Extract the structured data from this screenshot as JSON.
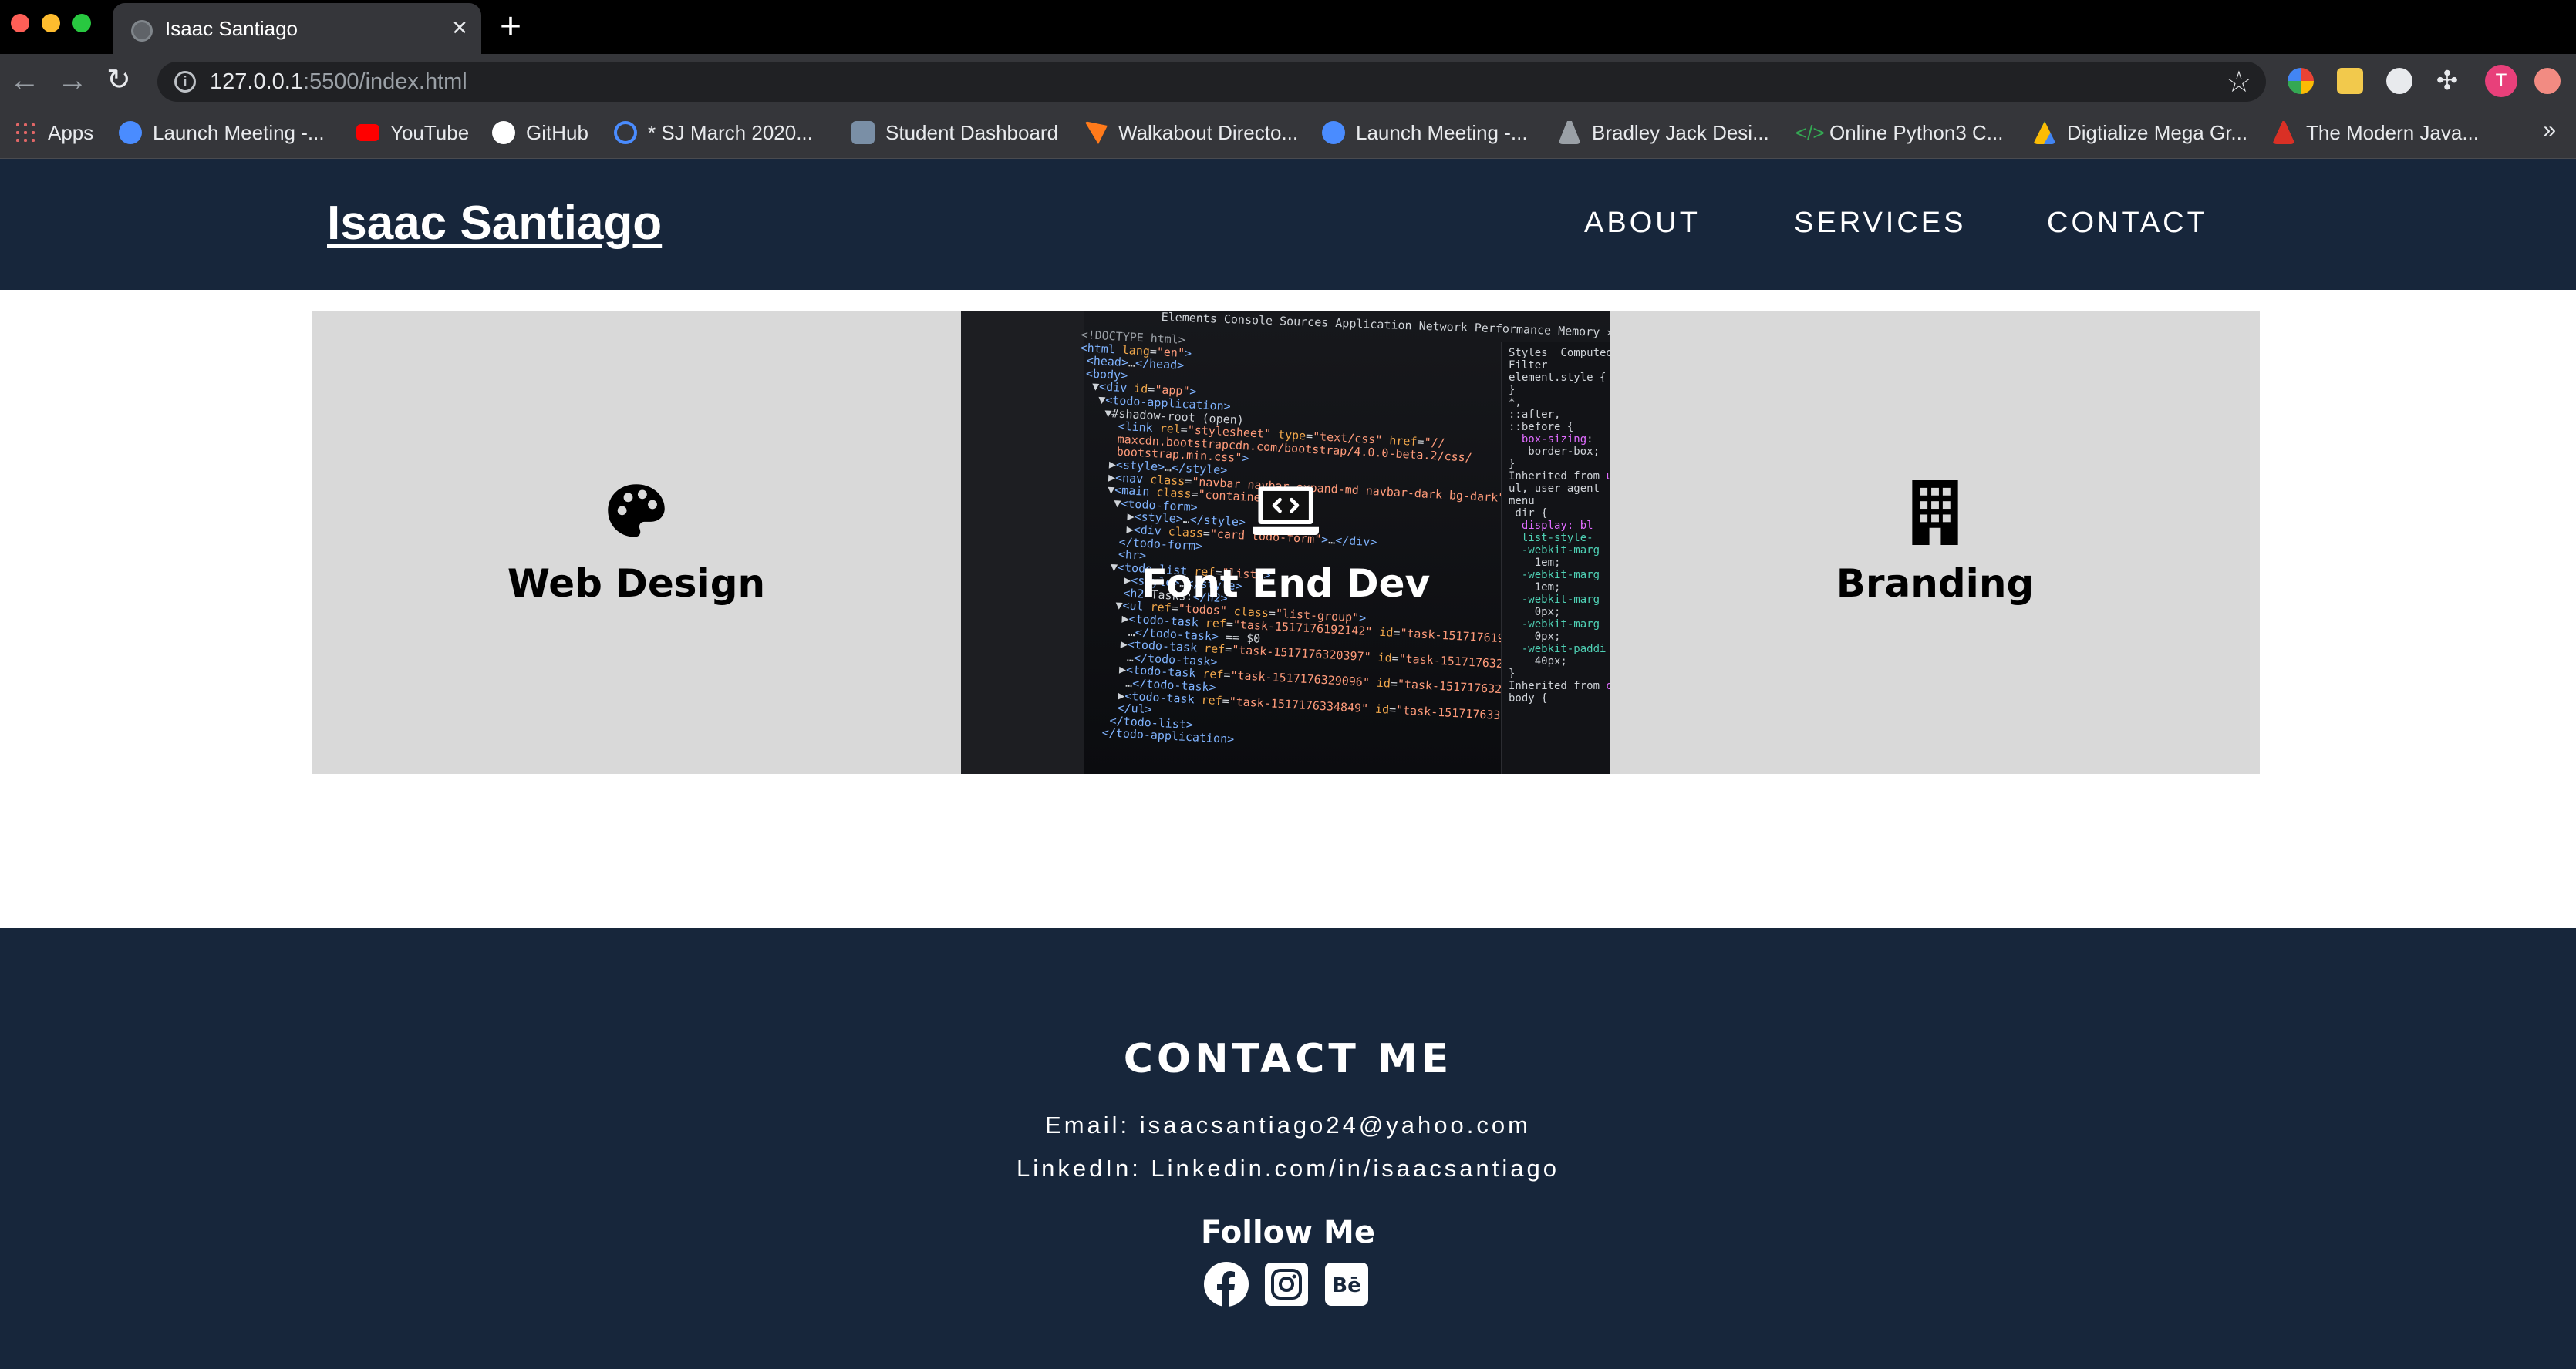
{
  "browser": {
    "tab_title": "Isaac Santiago",
    "tab_close": "×",
    "new_tab": "+",
    "url_host": "127.0.0.1",
    "url_rest": ":5500/index.html",
    "avatar_letter": "T",
    "bookmarks": [
      {
        "label": "Apps",
        "icon": "apps-grid-icon",
        "color": "#e06666"
      },
      {
        "label": "Launch Meeting -...",
        "icon": "zoom-icon",
        "color": "#4a8cff"
      },
      {
        "label": "YouTube",
        "icon": "youtube-icon",
        "color": "#ff0000"
      },
      {
        "label": "GitHub",
        "icon": "github-icon",
        "color": "#ffffff"
      },
      {
        "label": "* SJ March 2020...",
        "icon": "timer-icon",
        "color": "#4a8cff"
      },
      {
        "label": "Student Dashboard",
        "icon": "dashboard-icon",
        "color": "#7a8fa6"
      },
      {
        "label": "Walkabout Directo...",
        "icon": "walkabout-icon",
        "color": "#ff7a1a"
      },
      {
        "label": "Launch Meeting -...",
        "icon": "zoom-icon",
        "color": "#4a8cff"
      },
      {
        "label": "Bradley Jack Desi...",
        "icon": "figure-icon",
        "color": "#9aa0a6"
      },
      {
        "label": "Online Python3 C...",
        "icon": "code-icon",
        "color": "#34a853"
      },
      {
        "label": "Digtialize Mega Gr...",
        "icon": "google-drive-icon",
        "color": "#fbbc05"
      },
      {
        "label": "The Modern Java...",
        "icon": "figure-red-icon",
        "color": "#d93025"
      }
    ],
    "bookmarks_more": "»"
  },
  "site": {
    "brand": "Isaac Santiago",
    "nav": {
      "about": "ABOUT",
      "services": "SERVICES",
      "contact": "CONTACT"
    },
    "services": [
      {
        "title": "Web Design",
        "icon": "palette-icon"
      },
      {
        "title": "Font End Dev",
        "icon": "laptop-code-icon"
      },
      {
        "title": "Branding",
        "icon": "building-icon"
      }
    ],
    "footer": {
      "contact_title": "CONTACT ME",
      "email": "Email: isaacsantiago24@yahoo.com",
      "linkedin": "LinkedIn: Linkedin.com/in/isaacsantiago",
      "follow_title": "Follow Me",
      "social": [
        "facebook-icon",
        "instagram-icon",
        "behance-icon"
      ]
    }
  },
  "colors": {
    "header_bg": "#17263b",
    "card_bg": "#d9d9d9",
    "chrome_dark": "#35363a"
  }
}
